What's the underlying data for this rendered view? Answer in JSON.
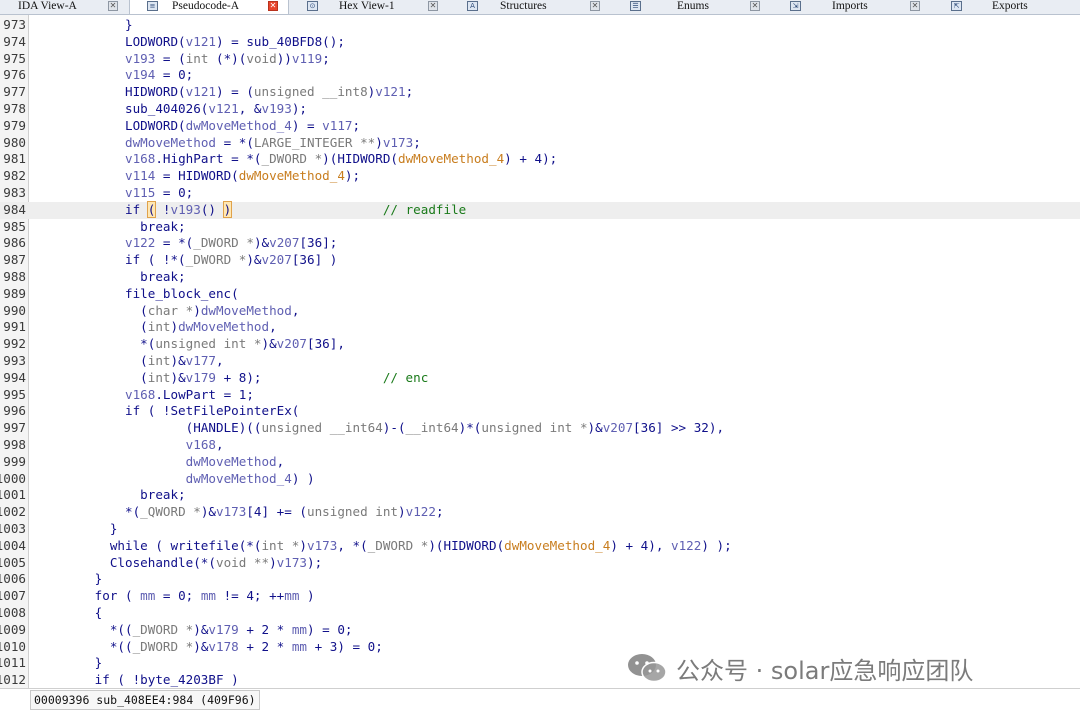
{
  "tabs": [
    {
      "label": "IDA View-A",
      "icon": "",
      "active": false
    },
    {
      "label": "Pseudocode-A",
      "icon": "",
      "active": true
    },
    {
      "label": "Hex View-1",
      "icon": "",
      "active": false
    },
    {
      "label": "Structures",
      "icon": "A",
      "active": false
    },
    {
      "label": "Enums",
      "icon": "",
      "active": false
    },
    {
      "label": "Imports",
      "icon": "",
      "active": false
    },
    {
      "label": "Exports",
      "icon": "",
      "active": false
    }
  ],
  "lines": [
    {
      "num": "973",
      "current": false,
      "tokens": [
        [
          "c",
          "            }"
        ]
      ]
    },
    {
      "num": "974",
      "current": false,
      "tokens": [
        [
          "c",
          "            LODWORD("
        ],
        [
          "v",
          "v121"
        ],
        [
          "c",
          ") = sub_40BFD8();"
        ]
      ]
    },
    {
      "num": "975",
      "current": false,
      "tokens": [
        [
          "c",
          "            "
        ],
        [
          "v",
          "v193"
        ],
        [
          "c",
          " = ("
        ],
        [
          "t",
          "int"
        ],
        [
          "c",
          " (*)("
        ],
        [
          "t",
          "void"
        ],
        [
          "c",
          "))"
        ],
        [
          "v",
          "v119"
        ],
        [
          "c",
          ";"
        ]
      ]
    },
    {
      "num": "976",
      "current": false,
      "tokens": [
        [
          "c",
          "            "
        ],
        [
          "v",
          "v194"
        ],
        [
          "c",
          " = 0;"
        ]
      ]
    },
    {
      "num": "977",
      "current": false,
      "tokens": [
        [
          "c",
          "            HIDWORD("
        ],
        [
          "v",
          "v121"
        ],
        [
          "c",
          ") = ("
        ],
        [
          "t",
          "unsigned __int8"
        ],
        [
          "c",
          ")"
        ],
        [
          "v",
          "v121"
        ],
        [
          "c",
          ";"
        ]
      ]
    },
    {
      "num": "978",
      "current": false,
      "tokens": [
        [
          "c",
          "            sub_404026("
        ],
        [
          "v",
          "v121"
        ],
        [
          "c",
          ", &"
        ],
        [
          "v",
          "v193"
        ],
        [
          "c",
          ");"
        ]
      ]
    },
    {
      "num": "979",
      "current": false,
      "tokens": [
        [
          "c",
          "            LODWORD("
        ],
        [
          "v",
          "dwMoveMethod_4"
        ],
        [
          "c",
          ") = "
        ],
        [
          "v",
          "v117"
        ],
        [
          "c",
          ";"
        ]
      ]
    },
    {
      "num": "980",
      "current": false,
      "tokens": [
        [
          "c",
          "            "
        ],
        [
          "v",
          "dwMoveMethod"
        ],
        [
          "c",
          " = *("
        ],
        [
          "t",
          "LARGE_INTEGER **"
        ],
        [
          "c",
          ")"
        ],
        [
          "v",
          "v173"
        ],
        [
          "c",
          ";"
        ]
      ]
    },
    {
      "num": "981",
      "current": false,
      "tokens": [
        [
          "c",
          "            "
        ],
        [
          "v",
          "v168"
        ],
        [
          "c",
          ".HighPart = *("
        ],
        [
          "t",
          "_DWORD *"
        ],
        [
          "c",
          ")(HIDWORD("
        ],
        [
          "a",
          "dwMoveMethod_4"
        ],
        [
          "c",
          ") + 4);"
        ]
      ]
    },
    {
      "num": "982",
      "current": false,
      "tokens": [
        [
          "c",
          "            "
        ],
        [
          "v",
          "v114"
        ],
        [
          "c",
          " = HIDWORD("
        ],
        [
          "a",
          "dwMoveMethod_4"
        ],
        [
          "c",
          ");"
        ]
      ]
    },
    {
      "num": "983",
      "current": false,
      "tokens": [
        [
          "c",
          "            "
        ],
        [
          "v",
          "v115"
        ],
        [
          "c",
          " = 0;"
        ]
      ]
    },
    {
      "num": "984",
      "current": true,
      "tokens": [
        [
          "c",
          "            if "
        ],
        [
          "h",
          "("
        ],
        [
          "c",
          " !"
        ],
        [
          "v",
          "v193"
        ],
        [
          "c",
          "() "
        ],
        [
          "h",
          ")"
        ],
        [
          "c",
          "                    "
        ],
        [
          "m",
          "// readfile"
        ]
      ]
    },
    {
      "num": "985",
      "current": false,
      "tokens": [
        [
          "c",
          "              break;"
        ]
      ]
    },
    {
      "num": "986",
      "current": false,
      "tokens": [
        [
          "c",
          "            "
        ],
        [
          "v",
          "v122"
        ],
        [
          "c",
          " = *("
        ],
        [
          "t",
          "_DWORD *"
        ],
        [
          "c",
          ")&"
        ],
        [
          "v",
          "v207"
        ],
        [
          "c",
          "[36];"
        ]
      ]
    },
    {
      "num": "987",
      "current": false,
      "tokens": [
        [
          "c",
          "            if ( !*("
        ],
        [
          "t",
          "_DWORD *"
        ],
        [
          "c",
          ")&"
        ],
        [
          "v",
          "v207"
        ],
        [
          "c",
          "[36] )"
        ]
      ]
    },
    {
      "num": "988",
      "current": false,
      "tokens": [
        [
          "c",
          "              break;"
        ]
      ]
    },
    {
      "num": "989",
      "current": false,
      "tokens": [
        [
          "c",
          "            file_block_enc("
        ]
      ]
    },
    {
      "num": "990",
      "current": false,
      "tokens": [
        [
          "c",
          "              ("
        ],
        [
          "t",
          "char *"
        ],
        [
          "c",
          ")"
        ],
        [
          "v",
          "dwMoveMethod"
        ],
        [
          "c",
          ","
        ]
      ]
    },
    {
      "num": "991",
      "current": false,
      "tokens": [
        [
          "c",
          "              ("
        ],
        [
          "t",
          "int"
        ],
        [
          "c",
          ")"
        ],
        [
          "v",
          "dwMoveMethod"
        ],
        [
          "c",
          ","
        ]
      ]
    },
    {
      "num": "992",
      "current": false,
      "tokens": [
        [
          "c",
          "              *("
        ],
        [
          "t",
          "unsigned int *"
        ],
        [
          "c",
          ")&"
        ],
        [
          "v",
          "v207"
        ],
        [
          "c",
          "[36],"
        ]
      ]
    },
    {
      "num": "993",
      "current": false,
      "tokens": [
        [
          "c",
          "              ("
        ],
        [
          "t",
          "int"
        ],
        [
          "c",
          ")&"
        ],
        [
          "v",
          "v177"
        ],
        [
          "c",
          ","
        ]
      ]
    },
    {
      "num": "994",
      "current": false,
      "tokens": [
        [
          "c",
          "              ("
        ],
        [
          "t",
          "int"
        ],
        [
          "c",
          ")&"
        ],
        [
          "v",
          "v179"
        ],
        [
          "c",
          " + 8);                "
        ],
        [
          "m",
          "// enc"
        ]
      ]
    },
    {
      "num": "995",
      "current": false,
      "tokens": [
        [
          "c",
          "            "
        ],
        [
          "v",
          "v168"
        ],
        [
          "c",
          ".LowPart = 1;"
        ]
      ]
    },
    {
      "num": "996",
      "current": false,
      "tokens": [
        [
          "c",
          "            if ( !SetFilePointerEx("
        ]
      ]
    },
    {
      "num": "997",
      "current": false,
      "tokens": [
        [
          "c",
          "                    (HANDLE)(("
        ],
        [
          "t",
          "unsigned __int64"
        ],
        [
          "c",
          ")-("
        ],
        [
          "t",
          "__int64"
        ],
        [
          "c",
          ")*("
        ],
        [
          "t",
          "unsigned int *"
        ],
        [
          "c",
          ")&"
        ],
        [
          "v",
          "v207"
        ],
        [
          "c",
          "[36] >> 32),"
        ]
      ]
    },
    {
      "num": "998",
      "current": false,
      "tokens": [
        [
          "c",
          "                    "
        ],
        [
          "v",
          "v168"
        ],
        [
          "c",
          ","
        ]
      ]
    },
    {
      "num": "999",
      "current": false,
      "tokens": [
        [
          "c",
          "                    "
        ],
        [
          "v",
          "dwMoveMethod"
        ],
        [
          "c",
          ","
        ]
      ]
    },
    {
      "num": "1000",
      "current": false,
      "tokens": [
        [
          "c",
          "                    "
        ],
        [
          "v",
          "dwMoveMethod_4"
        ],
        [
          "c",
          ") )"
        ]
      ]
    },
    {
      "num": "1001",
      "current": false,
      "tokens": [
        [
          "c",
          "              break;"
        ]
      ]
    },
    {
      "num": "1002",
      "current": false,
      "tokens": [
        [
          "c",
          "            *("
        ],
        [
          "t",
          "_QWORD *"
        ],
        [
          "c",
          ")&"
        ],
        [
          "v",
          "v173"
        ],
        [
          "c",
          "[4] += ("
        ],
        [
          "t",
          "unsigned int"
        ],
        [
          "c",
          ")"
        ],
        [
          "v",
          "v122"
        ],
        [
          "c",
          ";"
        ]
      ]
    },
    {
      "num": "1003",
      "current": false,
      "tokens": [
        [
          "c",
          "          }"
        ]
      ]
    },
    {
      "num": "1004",
      "current": false,
      "tokens": [
        [
          "c",
          "          while ( writefile(*("
        ],
        [
          "t",
          "int *"
        ],
        [
          "c",
          ")"
        ],
        [
          "v",
          "v173"
        ],
        [
          "c",
          ", *("
        ],
        [
          "t",
          "_DWORD *"
        ],
        [
          "c",
          ")(HIDWORD("
        ],
        [
          "a",
          "dwMoveMethod_4"
        ],
        [
          "c",
          ") + 4), "
        ],
        [
          "v",
          "v122"
        ],
        [
          "c",
          ") );"
        ]
      ]
    },
    {
      "num": "1005",
      "current": false,
      "tokens": [
        [
          "c",
          "          Closehandle(*("
        ],
        [
          "t",
          "void **"
        ],
        [
          "c",
          ")"
        ],
        [
          "v",
          "v173"
        ],
        [
          "c",
          ");"
        ]
      ]
    },
    {
      "num": "1006",
      "current": false,
      "tokens": [
        [
          "c",
          "        }"
        ]
      ]
    },
    {
      "num": "1007",
      "current": false,
      "tokens": [
        [
          "c",
          "        for ( "
        ],
        [
          "v",
          "mm"
        ],
        [
          "c",
          " = 0; "
        ],
        [
          "v",
          "mm"
        ],
        [
          "c",
          " != 4; ++"
        ],
        [
          "v",
          "mm"
        ],
        [
          "c",
          " )"
        ]
      ]
    },
    {
      "num": "1008",
      "current": false,
      "tokens": [
        [
          "c",
          "        {"
        ]
      ]
    },
    {
      "num": "1009",
      "current": false,
      "tokens": [
        [
          "c",
          "          *(("
        ],
        [
          "t",
          "_DWORD *"
        ],
        [
          "c",
          ")&"
        ],
        [
          "v",
          "v179"
        ],
        [
          "c",
          " + 2 * "
        ],
        [
          "v",
          "mm"
        ],
        [
          "c",
          ") = 0;"
        ]
      ]
    },
    {
      "num": "1010",
      "current": false,
      "tokens": [
        [
          "c",
          "          *(("
        ],
        [
          "t",
          "_DWORD *"
        ],
        [
          "c",
          ")&"
        ],
        [
          "v",
          "v178"
        ],
        [
          "c",
          " + 2 * "
        ],
        [
          "v",
          "mm"
        ],
        [
          "c",
          " + 3) = 0;"
        ]
      ]
    },
    {
      "num": "1011",
      "current": false,
      "tokens": [
        [
          "c",
          "        }"
        ]
      ]
    },
    {
      "num": "1012",
      "current": false,
      "tokens": [
        [
          "c",
          "        if ( !byte_4203BF )"
        ]
      ]
    }
  ],
  "status": {
    "address": "00009396 sub_408EE4:984 (409F96)"
  },
  "watermark": {
    "text": "公众号 · solar应急响应团队"
  }
}
